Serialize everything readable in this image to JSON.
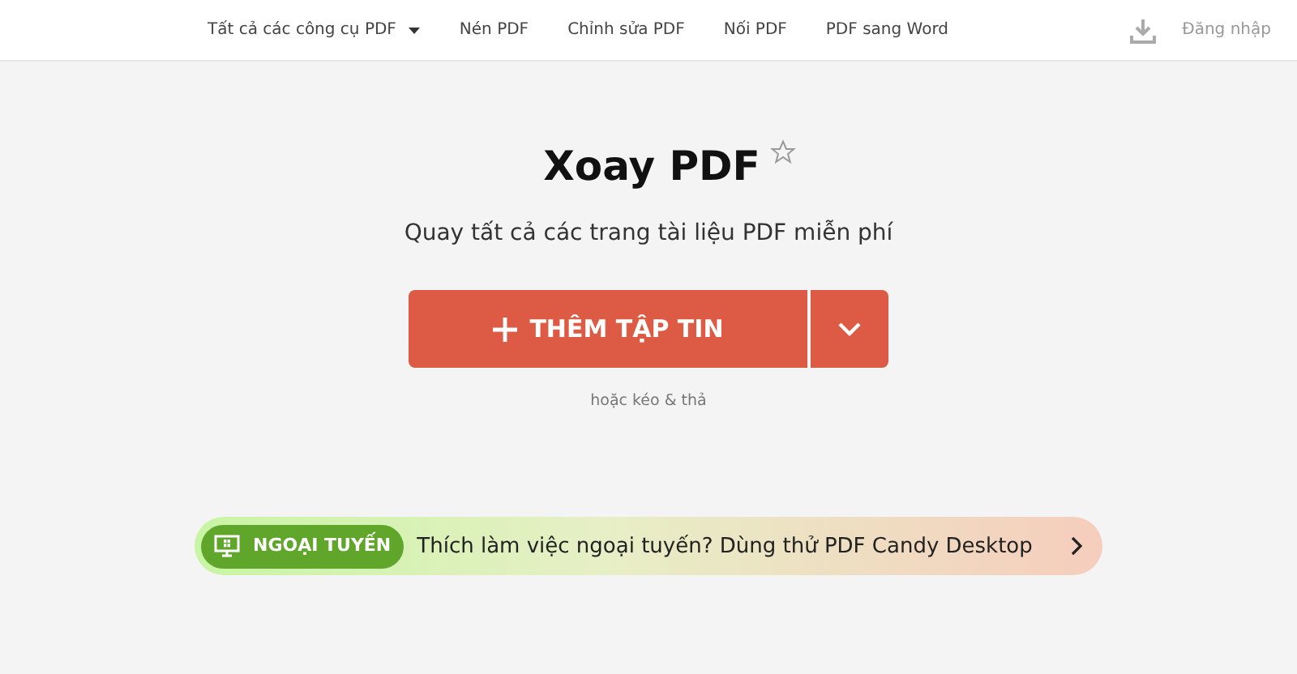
{
  "nav": {
    "items": [
      {
        "label": "Tất cả các công cụ PDF",
        "kind": "dropdown"
      },
      {
        "label": "Nén PDF",
        "kind": "link"
      },
      {
        "label": "Chỉnh sửa PDF",
        "kind": "link"
      },
      {
        "label": "Nối PDF",
        "kind": "link"
      },
      {
        "label": "PDF sang Word",
        "kind": "link"
      }
    ],
    "login": "Đăng nhập"
  },
  "title": "Xoay PDF",
  "favorite": false,
  "subtitle": "Quay tất cả các trang tài liệu PDF miễn phí",
  "add_button": {
    "label": "THÊM TẬP TIN"
  },
  "drop_hint": "hoặc kéo & thả",
  "banner": {
    "badge": "NGOẠI TUYẾN",
    "text": "Thích làm việc ngoại tuyến? Dùng thử PDF Candy Desktop"
  }
}
